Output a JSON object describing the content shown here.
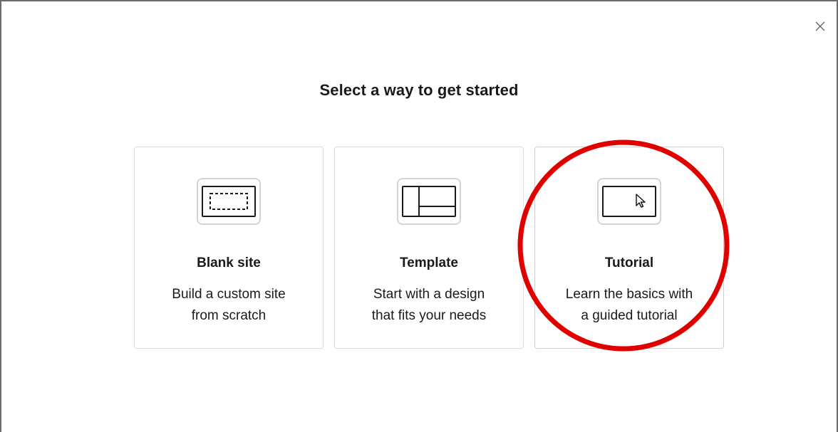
{
  "dialog": {
    "title": "Select a way to get started",
    "close_icon": "close-icon"
  },
  "options": [
    {
      "id": "blank",
      "title": "Blank site",
      "desc_line1": "Build a custom site",
      "desc_line2": "from scratch",
      "icon": "blank-site-icon"
    },
    {
      "id": "template",
      "title": "Template",
      "desc_line1": "Start with a design",
      "desc_line2": "that fits your needs",
      "icon": "template-layout-icon"
    },
    {
      "id": "tutorial",
      "title": "Tutorial",
      "desc_line1": "Learn the basics with",
      "desc_line2": "a guided tutorial",
      "icon": "cursor-window-icon"
    }
  ],
  "colors": {
    "annotation": "#e10000",
    "border": "#dddddd",
    "text": "#1a1a1a"
  }
}
